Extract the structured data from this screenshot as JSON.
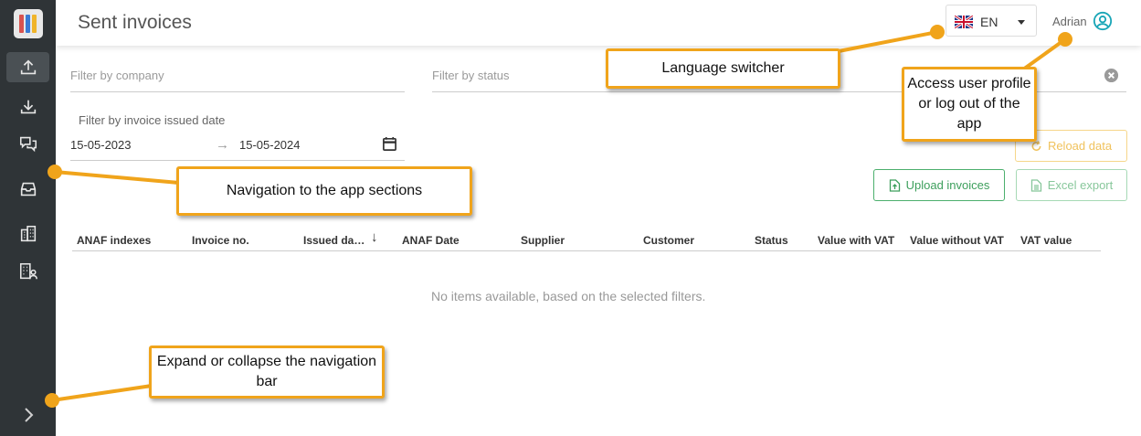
{
  "header": {
    "title": "Sent invoices",
    "language": {
      "code": "EN",
      "flag_icon": "uk-flag-icon"
    },
    "user": {
      "name": "Adrian",
      "icon": "user-circle-icon"
    }
  },
  "sidebar": {
    "logo_icon": "app-logo-icon",
    "items": [
      {
        "icon": "upload-icon",
        "active": true
      },
      {
        "icon": "download-icon",
        "active": false
      },
      {
        "icon": "chat-icon",
        "active": false
      },
      {
        "icon": "inbox-icon",
        "active": false
      },
      {
        "icon": "buildings-icon",
        "active": false
      },
      {
        "icon": "company-users-icon",
        "active": false
      }
    ],
    "expand_icon": "chevron-right-icon"
  },
  "filters": {
    "company_placeholder": "Filter by company",
    "status_placeholder": "Filter by status",
    "date_label": "Filter by invoice issued date",
    "date_from": "15-05-2023",
    "date_to": "15-05-2024"
  },
  "buttons": {
    "reload": "Reload data",
    "upload": "Upload invoices",
    "excel": "Excel export"
  },
  "table": {
    "columns": [
      "ANAF indexes",
      "Invoice no.",
      "Issued da…",
      "ANAF Date",
      "Supplier",
      "Customer",
      "Status",
      "Value with VAT",
      "Value without VAT",
      "VAT value"
    ],
    "sort_indicator": "↓",
    "empty_message": "No items available, based on the selected filters."
  },
  "callouts": {
    "language": "Language switcher",
    "user": "Access user profile or log out of the app",
    "navigation": "Navigation to the app sections",
    "expand": "Expand or collapse the navigation bar"
  },
  "colors": {
    "sidebar_bg": "#2f3437",
    "accent_teal": "#1aa6b7",
    "callout_border": "#f0a41b",
    "reload": "#f0c25c",
    "upload": "#3d9f5c"
  }
}
